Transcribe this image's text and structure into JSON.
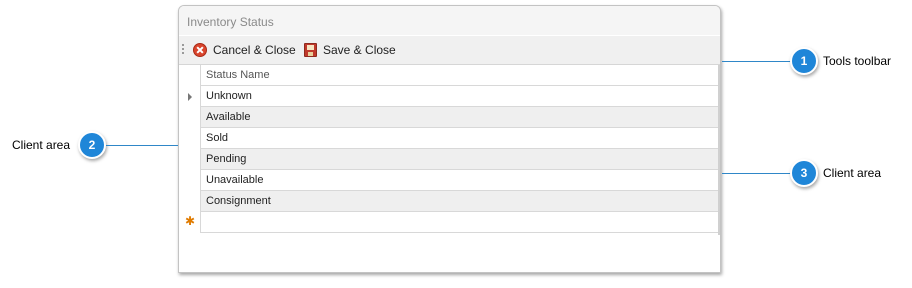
{
  "window": {
    "title": "Inventory Status"
  },
  "toolbar": {
    "cancel_label": "Cancel & Close",
    "save_label": "Save & Close",
    "cancel_icon": "cancel-icon",
    "save_icon": "save-icon"
  },
  "grid": {
    "column_header": "Status Name",
    "rows": [
      "Unknown",
      "Available",
      "Sold",
      "Pending",
      "Unavailable",
      "Consignment"
    ]
  },
  "callouts": [
    {
      "number": "1",
      "label": "Tools toolbar"
    },
    {
      "number": "2",
      "label": "Client area"
    },
    {
      "number": "3",
      "label": "Client area"
    }
  ],
  "colors": {
    "callout": "#1f86d8",
    "alt_row": "#efefef",
    "new_row_marker": "#e07b00"
  }
}
